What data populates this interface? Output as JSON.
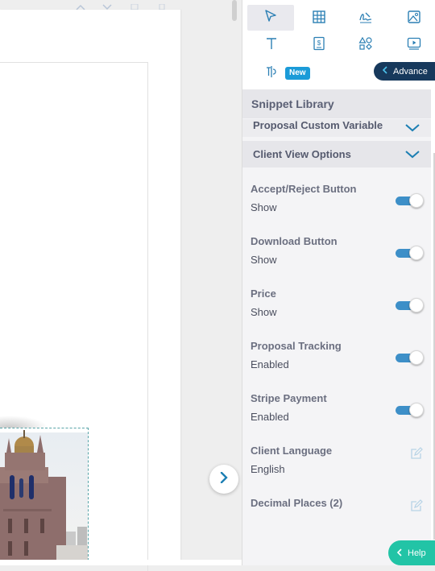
{
  "toolbar": {
    "tools_row1": [
      "pointer-icon",
      "table-icon",
      "signature-icon",
      "image-icon"
    ],
    "tools_row2": [
      "text-icon",
      "price-icon",
      "shapes-icon",
      "video-icon"
    ],
    "tools_row3": [
      "text-cursor-icon"
    ],
    "new_badge": "New",
    "advance_label": "Advance"
  },
  "panel": {
    "snippet_library": "Snippet Library",
    "accordions": [
      {
        "label": "Proposal Custom Variable"
      },
      {
        "label": "Client View Options"
      }
    ],
    "settings": [
      {
        "label": "Accept/Reject Button",
        "value": "Show",
        "control": "toggle",
        "on": true
      },
      {
        "label": "Download Button",
        "value": "Show",
        "control": "toggle",
        "on": true
      },
      {
        "label": "Price",
        "value": "Show",
        "control": "toggle",
        "on": true
      },
      {
        "label": "Proposal Tracking",
        "value": "Enabled",
        "control": "toggle",
        "on": true
      },
      {
        "label": "Stripe Payment",
        "value": "Enabled",
        "control": "toggle",
        "on": true
      },
      {
        "label": "Client Language",
        "value": "English",
        "control": "edit"
      },
      {
        "label": "Decimal Places (2)",
        "value": "",
        "control": "edit"
      }
    ]
  },
  "help": {
    "label": "Help"
  },
  "colors": {
    "accent": "#3d8fc8",
    "navy": "#17395c",
    "help_green": "#22c4a6",
    "badge_blue": "#1b9bd8"
  }
}
